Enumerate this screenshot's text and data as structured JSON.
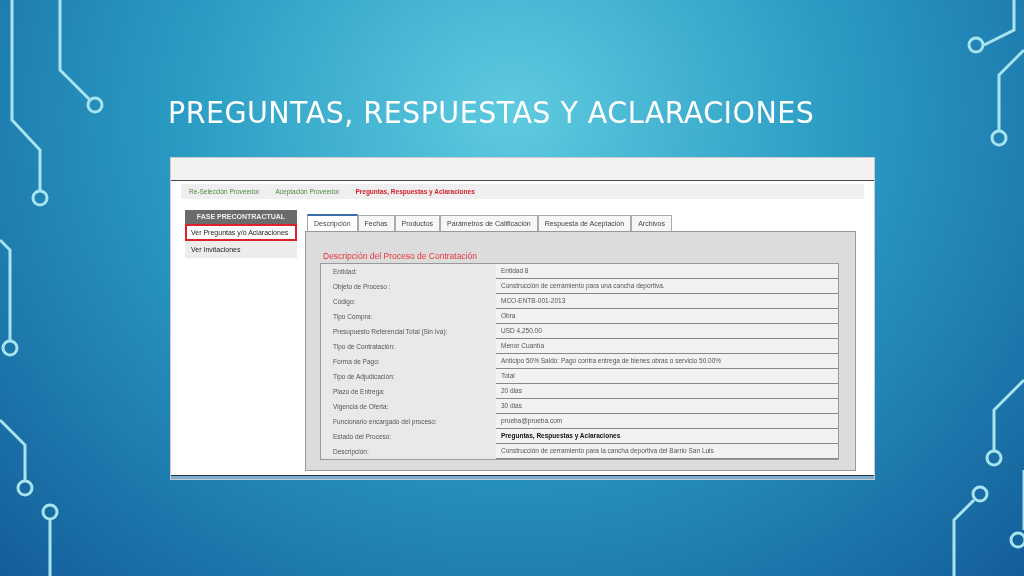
{
  "slide": {
    "title": "PREGUNTAS, RESPUESTAS Y ACLARACIONES"
  },
  "breadcrumb": [
    {
      "label": "Re-Selección Proveedor",
      "current": false
    },
    {
      "label": "Aceptación Proveedor",
      "current": false
    },
    {
      "label": "Preguntas, Respuestas y Aclaraciones",
      "current": true
    }
  ],
  "sidebar": {
    "header": "FASE PRECONTRACTUAL",
    "items": [
      {
        "label": "Ver Preguntas y/ó Aclaraciones",
        "highlighted": true
      },
      {
        "label": "Ver Invitaciones",
        "highlighted": false
      }
    ]
  },
  "tabs": [
    {
      "label": "Descripción",
      "selected": true
    },
    {
      "label": "Fechas",
      "selected": false
    },
    {
      "label": "Productos",
      "selected": false
    },
    {
      "label": "Parámetros de Calificación",
      "selected": false
    },
    {
      "label": "Respuesta de Aceptación",
      "selected": false
    },
    {
      "label": "Archivos",
      "selected": false
    }
  ],
  "section_title": "Descripción del Proceso de Contratación",
  "details": [
    {
      "label": "Entidad:",
      "value": "Entidad 8",
      "emphasis": false
    },
    {
      "label": "Objeto de Proceso :",
      "value": "Construcción de cerramiento para una cancha deportiva.",
      "emphasis": false
    },
    {
      "label": "Código:",
      "value": "MCO-ENTB-001-2013",
      "emphasis": false
    },
    {
      "label": "Tipo Compra:",
      "value": "Obra",
      "emphasis": false
    },
    {
      "label": "Presupuesto Referencial Total (Sin Iva):",
      "value": "USD 4,250.00",
      "emphasis": false
    },
    {
      "label": "Tipo de Contratación:",
      "value": "Menor Cuantía",
      "emphasis": false
    },
    {
      "label": "Forma de Pago:",
      "value": "Anticipo 50% Saldo: Pago contra entrega de bienes obras o servicio 50.00%",
      "emphasis": false
    },
    {
      "label": "Tipo de Adjudicación:",
      "value": "Total",
      "emphasis": false
    },
    {
      "label": "Plazo de Entrega:",
      "value": "20 dias",
      "emphasis": false
    },
    {
      "label": "Vigencia de Oferta:",
      "value": "30 dias",
      "emphasis": false
    },
    {
      "label": "Funcionario encargado del proceso:",
      "value": "prueba@prueba.com",
      "emphasis": false
    },
    {
      "label": "Estado del Proceso:",
      "value": "Preguntas, Respuestas y Aclaraciones",
      "emphasis": true
    },
    {
      "label": "Descripción:",
      "value": "Construcción de cerramiento para la cancha deportiva del Barrio San Luis",
      "emphasis": false
    }
  ]
}
